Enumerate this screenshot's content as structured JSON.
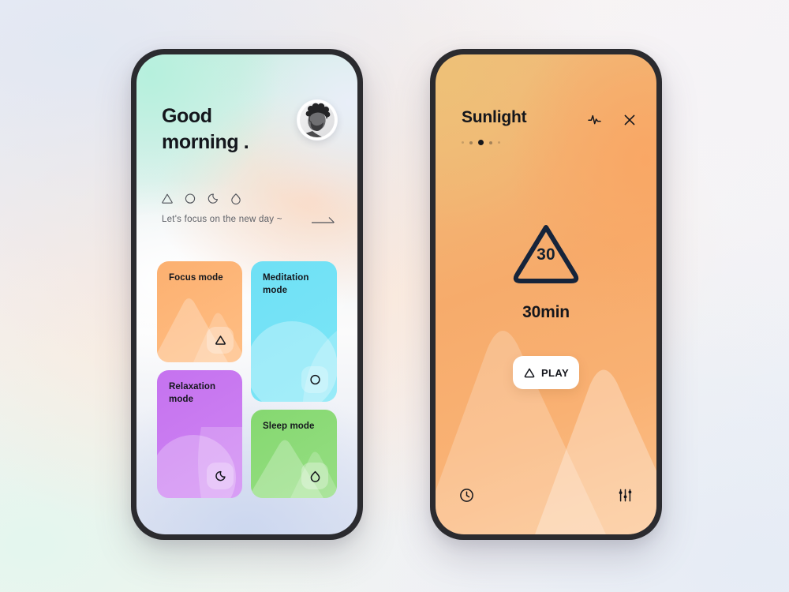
{
  "left_screen": {
    "greeting": "Good\nmorning .",
    "avatar_name": "user-avatar-photo",
    "shape_icons": [
      {
        "name": "triangle-icon"
      },
      {
        "name": "circle-icon"
      },
      {
        "name": "crescent-moon-icon"
      },
      {
        "name": "droplet-icon"
      }
    ],
    "tagline": "Let's focus on the new day ~",
    "arrow_icon": "arrow-right-icon",
    "cards": [
      {
        "id": "focus",
        "title": "Focus mode",
        "color": "#fcb070",
        "icon": "triangle-icon"
      },
      {
        "id": "meditation",
        "title": "Meditation\nmode",
        "color": "#6fe0f5",
        "icon": "circle-icon"
      },
      {
        "id": "relax",
        "title": "Relaxation\nmode",
        "color": "#c572ef",
        "icon": "crescent-moon-icon"
      },
      {
        "id": "sleep",
        "title": "Sleep mode",
        "color": "#85d870",
        "icon": "droplet-icon"
      }
    ]
  },
  "right_screen": {
    "title": "Sunlight",
    "pulse_icon": "activity-pulse-icon",
    "close_icon": "close-x-icon",
    "pagination": {
      "total": 5,
      "active_index": 2
    },
    "timer_value": "30",
    "timer_label": "30min",
    "play_label": "PLAY",
    "play_icon": "triangle-icon",
    "clock_icon": "clock-icon",
    "equalizer_icon": "equalizer-sliders-icon",
    "accent": "#f6ab6b"
  }
}
